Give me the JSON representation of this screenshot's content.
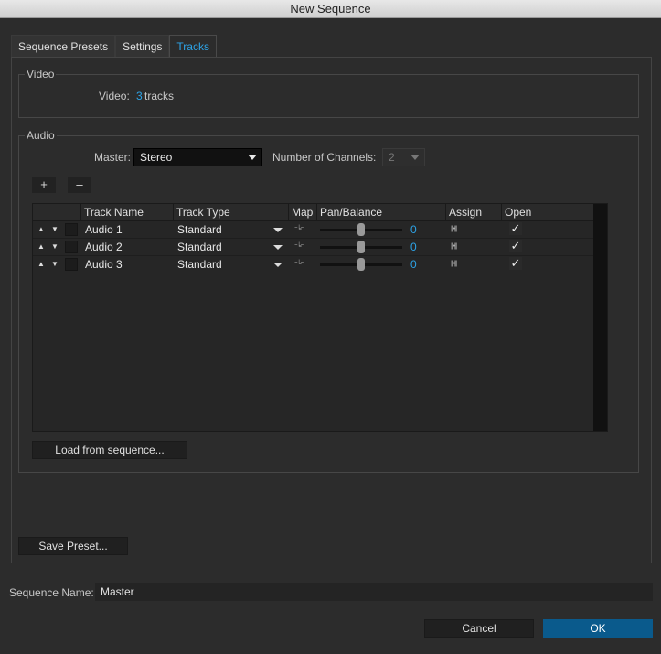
{
  "window": {
    "title": "New Sequence"
  },
  "tabs": [
    {
      "label": "Sequence Presets"
    },
    {
      "label": "Settings"
    },
    {
      "label": "Tracks",
      "active": true
    }
  ],
  "video": {
    "group_title": "Video",
    "label": "Video:",
    "count": "3",
    "unit": "tracks"
  },
  "audio": {
    "group_title": "Audio",
    "master_label": "Master:",
    "master_value": "Stereo",
    "channels_label": "Number of Channels:",
    "channels_value": "2",
    "add_label": "+",
    "remove_label": "–",
    "columns": [
      "Track Name",
      "Track Type",
      "Map",
      "Pan/Balance",
      "Assign",
      "Open"
    ],
    "tracks": [
      {
        "name": "Audio 1",
        "type": "Standard",
        "pan": "0",
        "open": "✓"
      },
      {
        "name": "Audio 2",
        "type": "Standard",
        "pan": "0",
        "open": "✓"
      },
      {
        "name": "Audio 3",
        "type": "Standard",
        "pan": "0",
        "open": "✓"
      }
    ],
    "load_button": "Load from sequence..."
  },
  "save_preset_button": "Save Preset...",
  "sequence_name": {
    "label": "Sequence Name:",
    "value": "Master"
  },
  "buttons": {
    "cancel": "Cancel",
    "ok": "OK"
  },
  "colors": {
    "accent": "#2da4e8",
    "ok_button": "#0a5a8c"
  },
  "icons": {
    "move_up": "up-triangle-icon",
    "move_down": "down-triangle-icon",
    "map": "channel-map-icon",
    "assign": "channel-assign-icon",
    "open": "checkmark-icon"
  }
}
